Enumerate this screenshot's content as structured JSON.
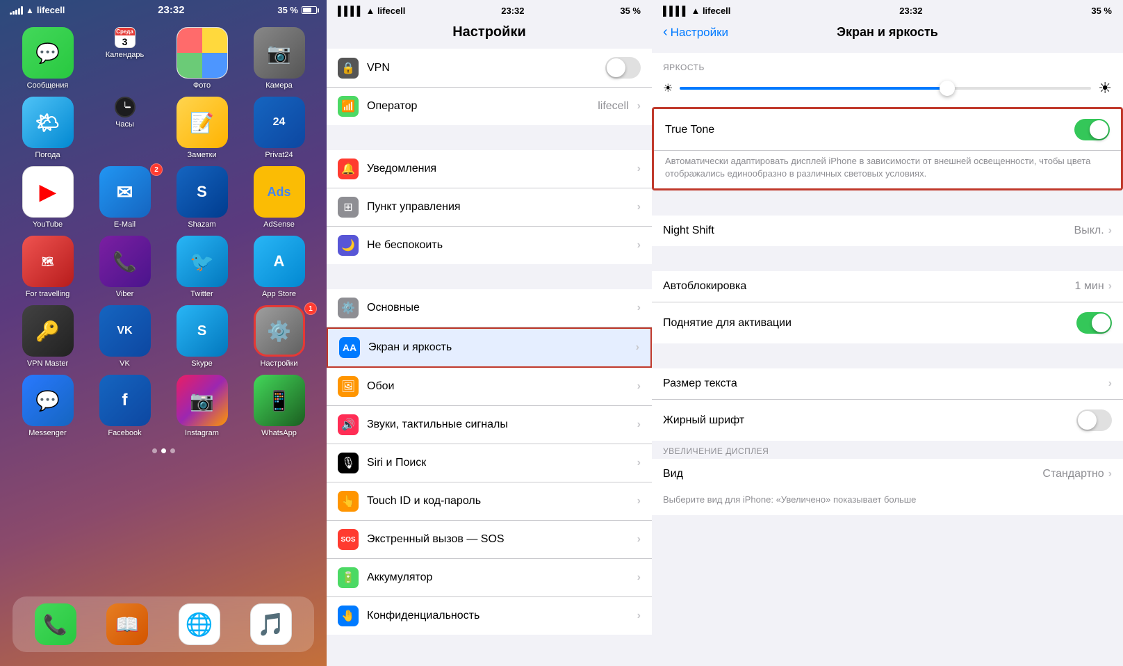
{
  "panel1": {
    "status": {
      "carrier": "lifecell",
      "time": "23:32",
      "battery": "35 %"
    },
    "apps": [
      {
        "id": "messages",
        "label": "Сообщения",
        "color": "app-messages",
        "icon": "💬",
        "badge": null
      },
      {
        "id": "calendar",
        "label": "Календарь",
        "color": "app-calendar",
        "icon": "cal",
        "badge": null
      },
      {
        "id": "photos",
        "label": "Фото",
        "color": "app-photos",
        "icon": "photos",
        "badge": null
      },
      {
        "id": "camera",
        "label": "Камера",
        "color": "app-camera",
        "icon": "📷",
        "badge": null
      },
      {
        "id": "weather",
        "label": "Погода",
        "color": "app-weather",
        "icon": "🌤",
        "badge": null
      },
      {
        "id": "clock",
        "label": "Часы",
        "color": "app-clock",
        "icon": "clock",
        "badge": null
      },
      {
        "id": "notes",
        "label": "Заметки",
        "color": "app-notes",
        "icon": "📝",
        "badge": null
      },
      {
        "id": "privat24",
        "label": "Privat24",
        "color": "app-privat",
        "icon": "24",
        "badge": null
      },
      {
        "id": "youtube",
        "label": "YouTube",
        "color": "app-youtube",
        "icon": "▶️",
        "badge": null
      },
      {
        "id": "email",
        "label": "E-Mail",
        "color": "app-email",
        "icon": "✉️",
        "badge": "2"
      },
      {
        "id": "shazam",
        "label": "Shazam",
        "color": "app-shazam",
        "icon": "S",
        "badge": null
      },
      {
        "id": "adsense",
        "label": "AdSense",
        "color": "app-adsense",
        "icon": "A",
        "badge": null
      },
      {
        "id": "fortravel",
        "label": "For travelling",
        "color": "app-fortravel",
        "icon": "🗺",
        "badge": null
      },
      {
        "id": "viber",
        "label": "Viber",
        "color": "app-viber",
        "icon": "📞",
        "badge": null
      },
      {
        "id": "twitter",
        "label": "Twitter",
        "color": "app-twitter",
        "icon": "🐦",
        "badge": null
      },
      {
        "id": "appstore",
        "label": "App Store",
        "color": "app-appstore",
        "icon": "A",
        "badge": null
      },
      {
        "id": "vpnmaster",
        "label": "VPN Master",
        "color": "app-vpnmaster",
        "icon": "🔑",
        "badge": null
      },
      {
        "id": "vk",
        "label": "VK",
        "color": "app-vk",
        "icon": "VK",
        "badge": null
      },
      {
        "id": "skype",
        "label": "Skype",
        "color": "app-skype",
        "icon": "S",
        "badge": null
      },
      {
        "id": "settings",
        "label": "Настройки",
        "color": "app-settings",
        "icon": "⚙️",
        "badge": "1",
        "highlight": true
      },
      {
        "id": "messenger",
        "label": "Messenger",
        "color": "app-messenger",
        "icon": "💬",
        "badge": null
      },
      {
        "id": "facebook",
        "label": "Facebook",
        "color": "app-facebook",
        "icon": "f",
        "badge": null
      },
      {
        "id": "instagram",
        "label": "Instagram",
        "color": "app-instagram",
        "icon": "📷",
        "badge": null
      },
      {
        "id": "whatsapp",
        "label": "WhatsApp",
        "color": "app-whatsapp",
        "icon": "📱",
        "badge": null
      }
    ],
    "dock": [
      {
        "id": "phone",
        "label": "",
        "color": "app-phone",
        "icon": "📞"
      },
      {
        "id": "books",
        "label": "",
        "color": "app-books",
        "icon": "📖"
      },
      {
        "id": "chrome",
        "label": "",
        "color": "app-chrome",
        "icon": "🌐"
      },
      {
        "id": "music",
        "label": "",
        "color": "app-music",
        "icon": "🎵"
      }
    ]
  },
  "panel2": {
    "status": {
      "carrier": "lifecell",
      "time": "23:32",
      "battery": "35 %"
    },
    "title": "Настройки",
    "rows": [
      {
        "id": "vpn",
        "icon": "🔒",
        "iconBg": "#555",
        "label": "VPN",
        "value": "",
        "hasToggle": true,
        "hasChevron": false
      },
      {
        "id": "carrier",
        "icon": "📶",
        "iconBg": "#4cd964",
        "label": "Оператор",
        "value": "lifecell",
        "hasToggle": false,
        "hasChevron": true
      },
      {
        "id": "divider1",
        "type": "divider"
      },
      {
        "id": "notifications",
        "icon": "🔔",
        "iconBg": "#ff3b30",
        "label": "Уведомления",
        "value": "",
        "hasToggle": false,
        "hasChevron": true
      },
      {
        "id": "controlcenter",
        "icon": "⊞",
        "iconBg": "#8e8e93",
        "label": "Пункт управления",
        "value": "",
        "hasToggle": false,
        "hasChevron": true
      },
      {
        "id": "donotdisturb",
        "icon": "🌙",
        "iconBg": "#5856d6",
        "label": "Не беспокоить",
        "value": "",
        "hasToggle": false,
        "hasChevron": true
      },
      {
        "id": "divider2",
        "type": "divider"
      },
      {
        "id": "general",
        "icon": "⚙️",
        "iconBg": "#8e8e93",
        "label": "Основные",
        "value": "",
        "hasToggle": false,
        "hasChevron": true
      },
      {
        "id": "display",
        "icon": "AA",
        "iconBg": "#007aff",
        "label": "Экран и яркость",
        "value": "",
        "hasToggle": false,
        "hasChevron": true,
        "selected": true
      },
      {
        "id": "wallpaper",
        "icon": "🖼",
        "iconBg": "#ff9500",
        "label": "Обои",
        "value": "",
        "hasToggle": false,
        "hasChevron": true
      },
      {
        "id": "sounds",
        "icon": "🔊",
        "iconBg": "#ff2d55",
        "label": "Звуки, тактильные сигналы",
        "value": "",
        "hasToggle": false,
        "hasChevron": true
      },
      {
        "id": "siri",
        "icon": "🎙",
        "iconBg": "#000",
        "label": "Siri и Поиск",
        "value": "",
        "hasToggle": false,
        "hasChevron": true
      },
      {
        "id": "touchid",
        "icon": "👆",
        "iconBg": "#ff9500",
        "label": "Touch ID и код-пароль",
        "value": "",
        "hasToggle": false,
        "hasChevron": true
      },
      {
        "id": "sos",
        "icon": "SOS",
        "iconBg": "#ff3b30",
        "label": "Экстренный вызов — SOS",
        "value": "",
        "hasToggle": false,
        "hasChevron": true
      },
      {
        "id": "battery",
        "icon": "🔋",
        "iconBg": "#4cd964",
        "label": "Аккумулятор",
        "value": "",
        "hasToggle": false,
        "hasChevron": true
      },
      {
        "id": "privacy",
        "icon": "🤚",
        "iconBg": "#007aff",
        "label": "Конфиденциальность",
        "value": "",
        "hasToggle": false,
        "hasChevron": true
      }
    ]
  },
  "panel3": {
    "status": {
      "carrier": "lifecell",
      "time": "23:32",
      "battery": "35 %"
    },
    "backLabel": "Настройки",
    "title": "Экран и яркость",
    "brightnessLabel": "ЯРКОСТЬ",
    "brightnessValue": 65,
    "trueToneLabel": "True Tone",
    "trueToneOn": true,
    "trueToneDesc": "Автоматически адаптировать дисплей iPhone в зависимости от внешней освещенности, чтобы цвета отображались единообразно в различных световых условиях.",
    "nightShiftLabel": "Night Shift",
    "nightShiftValue": "Выкл.",
    "autolockLabel": "Автоблокировка",
    "autolockValue": "1 мин",
    "raiseLabel": "Поднятие для активации",
    "raiseOn": true,
    "textSizeLabel": "Размер текста",
    "boldLabel": "Жирный шрифт",
    "boldOn": false,
    "zoomSectionLabel": "УВЕЛИЧЕНИЕ ДИСПЛЕЯ",
    "viewLabel": "Вид",
    "viewValue": "Стандартно",
    "viewDesc": "Выберите вид для iPhone: «Увеличено» показывает больше"
  }
}
